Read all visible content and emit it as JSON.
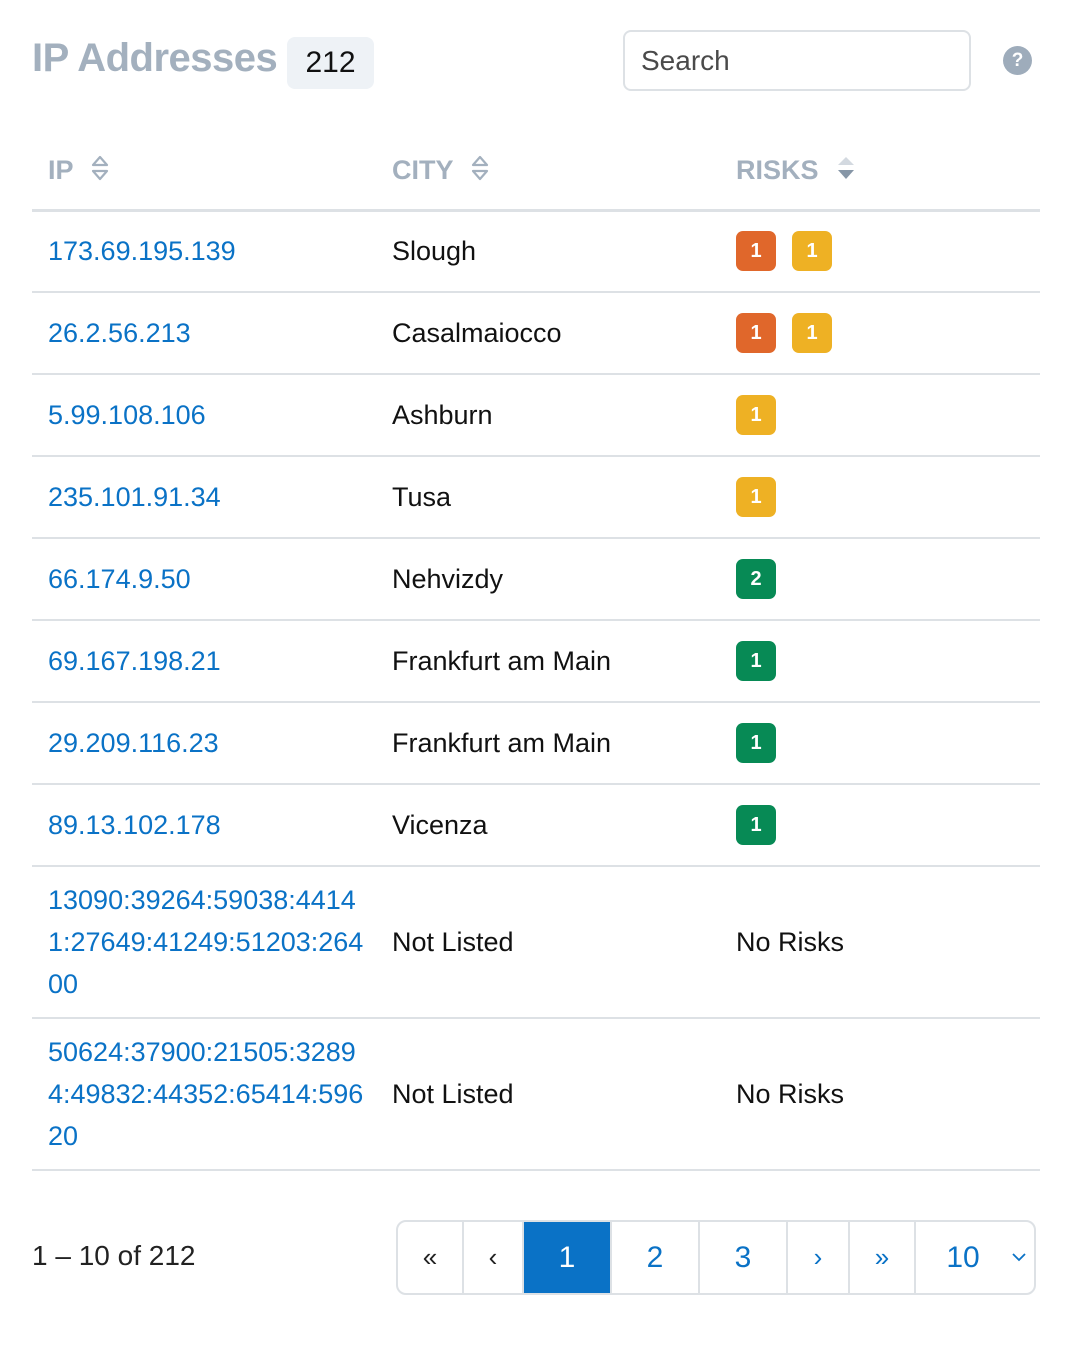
{
  "header": {
    "title": "IP Addresses",
    "count": "212",
    "search_placeholder": "Search",
    "help_icon": "?"
  },
  "table": {
    "columns": [
      {
        "label": "IP",
        "sort_icon": "sort-icon"
      },
      {
        "label": "CITY",
        "sort_icon": "sort-icon"
      },
      {
        "label": "RISKS",
        "sort_icon": "sort-desc-icon"
      }
    ],
    "risk_colors": {
      "high": "#e0672b",
      "medium": "#eeb124",
      "low": "#078a55"
    },
    "rows": [
      {
        "ip": "173.69.195.139",
        "city": "Slough",
        "risks": [
          {
            "level": "high",
            "count": "1"
          },
          {
            "level": "med",
            "count": "1"
          }
        ]
      },
      {
        "ip": "26.2.56.213",
        "city": "Casalmaiocco",
        "risks": [
          {
            "level": "high",
            "count": "1"
          },
          {
            "level": "med",
            "count": "1"
          }
        ]
      },
      {
        "ip": "5.99.108.106",
        "city": "Ashburn",
        "risks": [
          {
            "level": "med",
            "count": "1"
          }
        ]
      },
      {
        "ip": "235.101.91.34",
        "city": "Tusa",
        "risks": [
          {
            "level": "med",
            "count": "1"
          }
        ]
      },
      {
        "ip": "66.174.9.50",
        "city": "Nehvizdy",
        "risks": [
          {
            "level": "low",
            "count": "2"
          }
        ]
      },
      {
        "ip": "69.167.198.21",
        "city": "Frankfurt am Main",
        "risks": [
          {
            "level": "low",
            "count": "1"
          }
        ]
      },
      {
        "ip": "29.209.116.23",
        "city": "Frankfurt am Main",
        "risks": [
          {
            "level": "low",
            "count": "1"
          }
        ]
      },
      {
        "ip": "89.13.102.178",
        "city": "Vicenza",
        "risks": [
          {
            "level": "low",
            "count": "1"
          }
        ]
      },
      {
        "ip": "13090:39264:59038:44141:27649:41249:51203:26400",
        "city": "Not Listed",
        "risks_text": "No Risks"
      },
      {
        "ip": "50624:37900:21505:32894:49832:44352:65414:59620",
        "city": "Not Listed",
        "risks_text": "No Risks"
      }
    ]
  },
  "footer": {
    "range": "1 – 10 of 212",
    "pager": {
      "first": "«",
      "prev": "‹",
      "pages": [
        "1",
        "2",
        "3"
      ],
      "active_page": "1",
      "next": "›",
      "last": "»",
      "per_page": "10",
      "per_page_chevron": "⌄"
    }
  }
}
